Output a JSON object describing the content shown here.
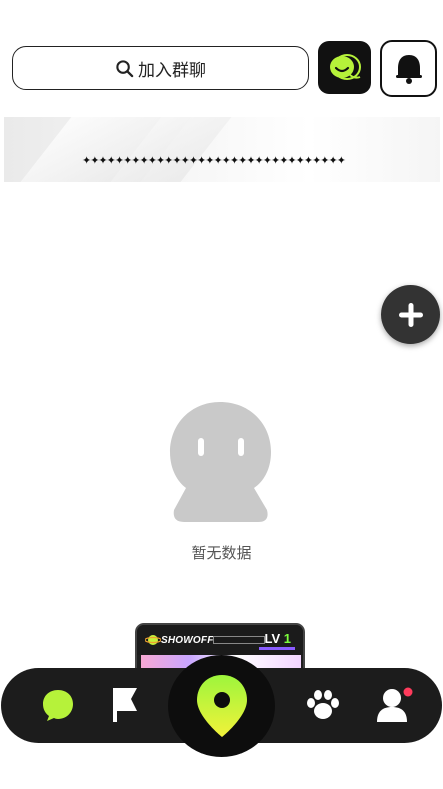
{
  "search": {
    "label": "加入群聊"
  },
  "banner": {
    "text": "✦✦✦✦✦✦✦✦✦✦✦✦✦✦✦✦✦✦✦✦✦✦✦✦✦✦✦✦✦✦✦✦"
  },
  "empty_state": {
    "message": "暂无数据"
  },
  "game_card": {
    "logo": "SHOWOFF",
    "level_prefix": "LV",
    "level_value": "1"
  },
  "colors": {
    "accent_green": "#b6f23a",
    "nav_bg": "#1c1c1c",
    "notification_dot": "#ff3b5c"
  },
  "nav": {
    "items": [
      {
        "icon": "chat-bubble-icon"
      },
      {
        "icon": "flag-icon"
      },
      {
        "icon": "map-pin-icon"
      },
      {
        "icon": "paw-icon"
      },
      {
        "icon": "profile-icon"
      }
    ]
  }
}
